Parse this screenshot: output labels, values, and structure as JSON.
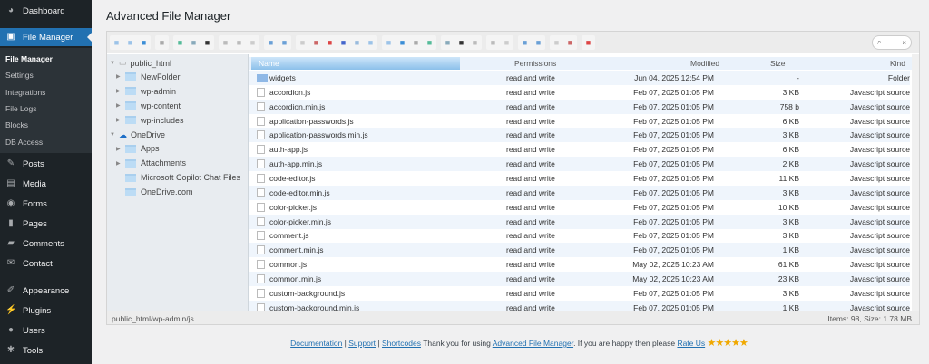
{
  "sidebar": {
    "items": [
      {
        "label": "Dashboard",
        "icon": "dashboard-icon",
        "glyph": "◕"
      },
      {
        "label": "File Manager",
        "icon": "file-manager-icon",
        "glyph": "▣"
      },
      {
        "label": "Posts",
        "icon": "pin-icon",
        "glyph": "✎"
      },
      {
        "label": "Media",
        "icon": "media-icon",
        "glyph": "▤"
      },
      {
        "label": "Forms",
        "icon": "forms-icon",
        "glyph": "◉"
      },
      {
        "label": "Pages",
        "icon": "pages-icon",
        "glyph": "▮"
      },
      {
        "label": "Comments",
        "icon": "comments-icon",
        "glyph": "▰"
      },
      {
        "label": "Contact",
        "icon": "mail-icon",
        "glyph": "✉"
      },
      {
        "label": "Appearance",
        "icon": "brush-icon",
        "glyph": "✐"
      },
      {
        "label": "Plugins",
        "icon": "plugin-icon",
        "glyph": "⚡"
      },
      {
        "label": "Users",
        "icon": "users-icon",
        "glyph": "●"
      },
      {
        "label": "Tools",
        "icon": "wrench-icon",
        "glyph": "✱"
      }
    ],
    "submenu": [
      "File Manager",
      "Settings",
      "Integrations",
      "File Logs",
      "Blocks",
      "DB Access"
    ]
  },
  "title": "Advanced File Manager",
  "tree": [
    {
      "label": "public_html",
      "level": 0,
      "expanded": true
    },
    {
      "label": "NewFolder",
      "level": 1
    },
    {
      "label": "wp-admin",
      "level": 1
    },
    {
      "label": "wp-content",
      "level": 1
    },
    {
      "label": "wp-includes",
      "level": 1
    },
    {
      "label": "OneDrive",
      "level": 0,
      "expanded": true
    },
    {
      "label": "Apps",
      "level": 1
    },
    {
      "label": "Attachments",
      "level": 1
    },
    {
      "label": "Microsoft Copilot Chat Files",
      "level": 1,
      "leaf": true
    },
    {
      "label": "OneDrive.com",
      "level": 1,
      "leaf": true
    }
  ],
  "columns": {
    "name": "Name",
    "perm": "Permissions",
    "mod": "Modified",
    "size": "Size",
    "kind": "Kind"
  },
  "files": [
    [
      "widgets",
      "read and write",
      "Jun 04, 2025 12:54 PM",
      "-",
      "Folder"
    ],
    [
      "accordion.js",
      "read and write",
      "Feb 07, 2025 01:05 PM",
      "3 KB",
      "Javascript source"
    ],
    [
      "accordion.min.js",
      "read and write",
      "Feb 07, 2025 01:05 PM",
      "758 b",
      "Javascript source"
    ],
    [
      "application-passwords.js",
      "read and write",
      "Feb 07, 2025 01:05 PM",
      "6 KB",
      "Javascript source"
    ],
    [
      "application-passwords.min.js",
      "read and write",
      "Feb 07, 2025 01:05 PM",
      "3 KB",
      "Javascript source"
    ],
    [
      "auth-app.js",
      "read and write",
      "Feb 07, 2025 01:05 PM",
      "6 KB",
      "Javascript source"
    ],
    [
      "auth-app.min.js",
      "read and write",
      "Feb 07, 2025 01:05 PM",
      "2 KB",
      "Javascript source"
    ],
    [
      "code-editor.js",
      "read and write",
      "Feb 07, 2025 01:05 PM",
      "11 KB",
      "Javascript source"
    ],
    [
      "code-editor.min.js",
      "read and write",
      "Feb 07, 2025 01:05 PM",
      "3 KB",
      "Javascript source"
    ],
    [
      "color-picker.js",
      "read and write",
      "Feb 07, 2025 01:05 PM",
      "10 KB",
      "Javascript source"
    ],
    [
      "color-picker.min.js",
      "read and write",
      "Feb 07, 2025 01:05 PM",
      "3 KB",
      "Javascript source"
    ],
    [
      "comment.js",
      "read and write",
      "Feb 07, 2025 01:05 PM",
      "3 KB",
      "Javascript source"
    ],
    [
      "comment.min.js",
      "read and write",
      "Feb 07, 2025 01:05 PM",
      "1 KB",
      "Javascript source"
    ],
    [
      "common.js",
      "read and write",
      "May 02, 2025 10:23 AM",
      "61 KB",
      "Javascript source"
    ],
    [
      "common.min.js",
      "read and write",
      "May 02, 2025 10:23 AM",
      "23 KB",
      "Javascript source"
    ],
    [
      "custom-background.js",
      "read and write",
      "Feb 07, 2025 01:05 PM",
      "3 KB",
      "Javascript source"
    ],
    [
      "custom-background.min.js",
      "read and write",
      "Feb 07, 2025 01:05 PM",
      "1 KB",
      "Javascript source"
    ]
  ],
  "status": {
    "path": "public_html/wp-admin/js",
    "summary": "Items: 98, Size: 1.78 MB"
  },
  "footer": {
    "doc": "Documentation",
    "support": "Support",
    "shortcodes": "Shortcodes",
    "thanks": "Thank you for using",
    "afm": "Advanced File Manager",
    "happy": ". If you are happy then please",
    "rate": "Rate Us",
    "stars": "★★★★★"
  },
  "search": {
    "icon": "⌕",
    "clear": "×"
  }
}
